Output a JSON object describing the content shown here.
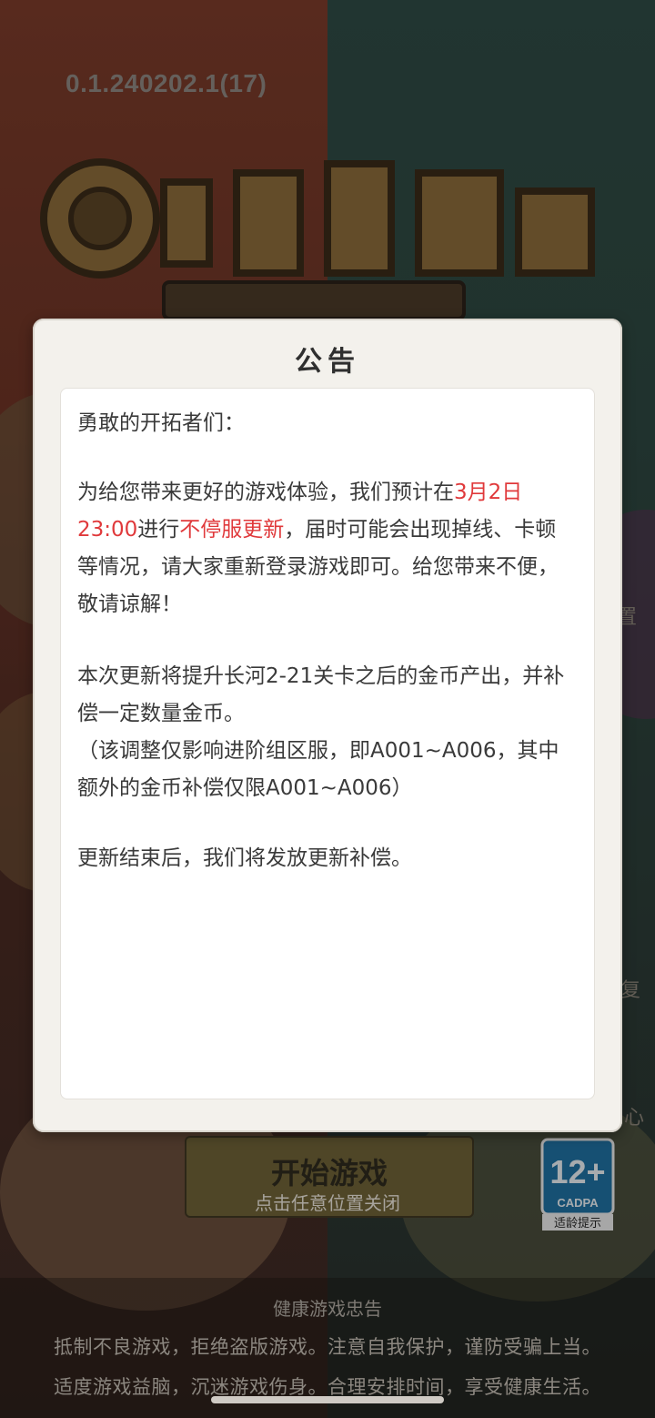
{
  "background": {
    "version": "0.1.240202.1(17)",
    "side_text_1": "置",
    "side_text_2": "复",
    "side_text_3": "心",
    "start_button_label": "开始游戏",
    "close_hint": "点击任意位置关闭",
    "age_rating": {
      "number": "12+",
      "org": "CADPA",
      "caption": "适龄提示"
    },
    "health_notice": {
      "title": "健康游戏忠告",
      "line1": "抵制不良游戏，拒绝盗版游戏。注意自我保护，谨防受骗上当。",
      "line2": "适度游戏益脑，沉迷游戏伤身。合理安排时间，享受健康生活。"
    }
  },
  "modal": {
    "title": "公告",
    "greeting": "勇敢的开拓者们：",
    "para1": {
      "part1": "为给您带来更好的游戏体验，我们预计在",
      "date_red": "3月2日23:00",
      "part2": "进行",
      "update_red": "不停服更新",
      "part3": "，届时可能会出现掉线、卡顿等情况，请大家重新登录游戏即可。给您带来不便，敬请谅解！"
    },
    "para2": "本次更新将提升长河2-21关卡之后的金币产出，并补偿一定数量金币。",
    "para3": "（该调整仅影响进阶组区服，即A001~A006，其中额外的金币补偿仅限A001~A006）",
    "para4": "更新结束后，我们将发放更新补偿。"
  },
  "colors": {
    "highlight_red": "#e0393b",
    "modal_bg": "#f3f1ec",
    "content_bg": "#ffffff"
  }
}
